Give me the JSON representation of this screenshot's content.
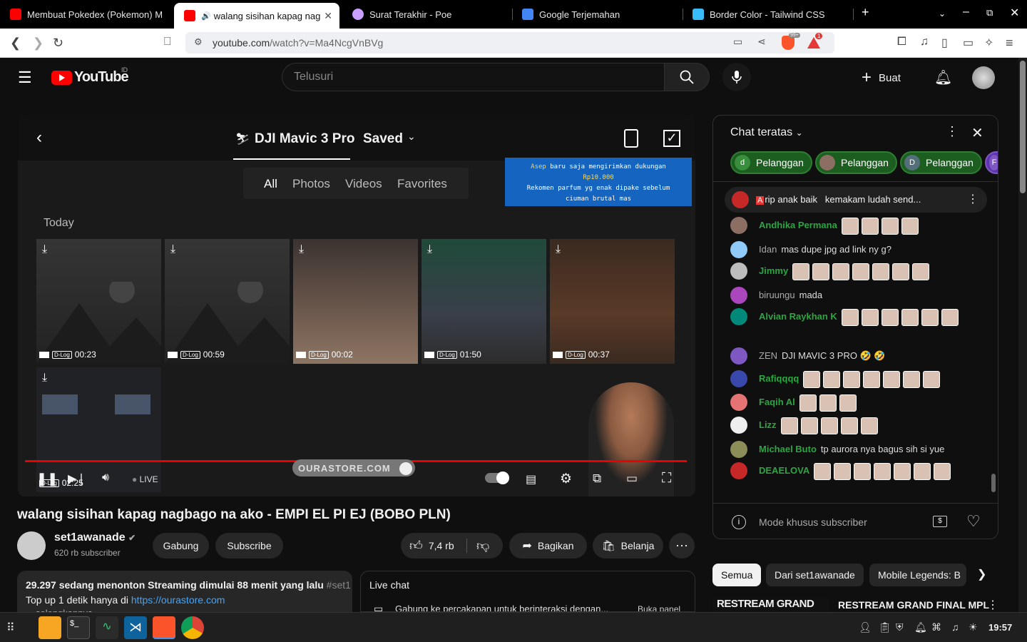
{
  "browser": {
    "tabs": [
      {
        "title": "Membuat Pokedex (Pokemon) M",
        "color": "#ff0000"
      },
      {
        "title": "walang sisihan kapag nag",
        "color": "#ff0000",
        "active": true
      },
      {
        "title": "Surat Terakhir - Poe",
        "color": "#c9a0ff"
      },
      {
        "title": "Google Terjemahan",
        "color": "#4285f4"
      },
      {
        "title": "Border Color - Tailwind CSS",
        "color": "#38bdf8"
      }
    ],
    "new_tab": "+",
    "url_host": "youtube.com",
    "url_path": "/watch?v=Ma4NcgVnBVg",
    "brave_badge": "99+",
    "alert_badge": "1"
  },
  "yt": {
    "logo": "YouTube",
    "region": "ID",
    "search_placeholder": "Telusuri",
    "create_label": "Buat"
  },
  "player": {
    "app_title": "DJI Mavic 3 Pro",
    "saved_label": "Saved",
    "filters": [
      "All",
      "Photos",
      "Videos",
      "Favorites"
    ],
    "today_label": "Today",
    "durations": [
      "00:23",
      "00:59",
      "00:02",
      "01:50",
      "00:37",
      "02:25"
    ],
    "dlog_label": "D-Log",
    "watermark": "OURASTORE.COM",
    "live_label": "LIVE",
    "donation": {
      "line1_name": "Asep",
      "line1_text": "baru saja mengirimkan dukungan",
      "amount": "Rp10.000",
      "line3": "Rekomen parfum yg enak dipake sebelum",
      "line4": "ciuman brutal mas"
    }
  },
  "video": {
    "title": "walang sisihan kapag nagbago na ako - EMPI EL PI EJ (BOBO PLN)",
    "channel": "set1awanade",
    "subscribers": "620 rb subscriber",
    "join_label": "Gabung",
    "subscribe_label": "Subscribe",
    "likes": "7,4 rb",
    "share_label": "Bagikan",
    "shop_label": "Belanja",
    "desc_stats": "29.297 sedang menonton  Streaming dimulai 88 menit yang lalu",
    "desc_hashtag": "#set1",
    "desc_line2": "Top up 1 detik hanya di",
    "desc_link": "https://ourastore.com",
    "desc_line3": "selengkapnya",
    "livechat_label": "Live chat",
    "livechat_join": "Gabung ke percakapan untuk berinteraksi dengan...",
    "livechat_open": "Buka panel"
  },
  "chat": {
    "header": "Chat teratas",
    "chips": [
      {
        "initial": "d",
        "label": "Pelanggan"
      },
      {
        "initial": "",
        "label": "Pelanggan"
      },
      {
        "initial": "D",
        "label": "Pelanggan"
      },
      {
        "initial": "F",
        "label": ""
      }
    ],
    "pinned_name": "rip anak baik",
    "pinned_text": "kemakam ludah send...",
    "messages": [
      {
        "name": "Andhika Permana",
        "text": "",
        "emotes": 4,
        "color": "#8d6e63"
      },
      {
        "name": "Idan",
        "text": "mas dupe jpg ad link ny g?",
        "emotes": 0,
        "color": "#90caf9",
        "gray": true
      },
      {
        "name": "Jimmy",
        "text": "",
        "emotes": 7,
        "color": "#bdbdbd"
      },
      {
        "name": "biruungu",
        "text": "mada",
        "emotes": 0,
        "color": "#ab47bc",
        "gray": true
      },
      {
        "name": "Alvian Raykhan K",
        "text": "",
        "emotes": 6,
        "color": "#00897b"
      },
      {
        "name": "ZEN",
        "text": "DJI MAVIC 3 PRO 🤣 🤣",
        "emotes": 0,
        "color": "#7e57c2",
        "gray": true
      },
      {
        "name": "Rafiqqqq",
        "text": "",
        "emotes": 7,
        "color": "#3949ab"
      },
      {
        "name": "Faqih Al",
        "text": "",
        "emotes": 3,
        "color": "#e57373"
      },
      {
        "name": "Lizz",
        "text": "",
        "emotes": 5,
        "color": "#eeeeee"
      },
      {
        "name": "Michael Buto",
        "text": "tp aurora nya bagus sih si yue",
        "emotes": 0,
        "color": "#8d8d5a"
      },
      {
        "name": "DEAELOVA",
        "text": "",
        "emotes": 7,
        "color": "#c62828"
      }
    ],
    "input_placeholder": "Mode khusus subscriber"
  },
  "feed": {
    "chips": [
      "Semua",
      "Dari set1awanade",
      "Mobile Legends: B"
    ],
    "rec_thumb": "RESTREAM GRAND FINAL",
    "rec_title": "RESTREAM GRAND FINAL MPL"
  },
  "taskbar": {
    "time": "19:57"
  }
}
